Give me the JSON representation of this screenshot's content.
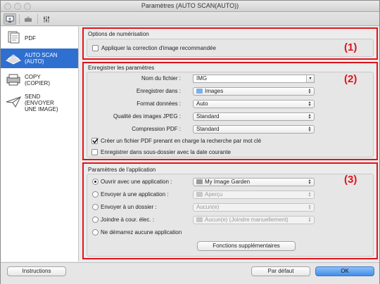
{
  "window": {
    "title": "Paramètres (AUTO SCAN(AUTO))"
  },
  "toolbar": {
    "icons": [
      "scan-from-computer-icon",
      "scan-from-operation-panel-icon",
      "general-settings-icon"
    ]
  },
  "sidebar": {
    "items": [
      {
        "label": "PDF",
        "icon": "pdf-icon",
        "selected": false
      },
      {
        "label": "AUTO SCAN\n(AUTO)",
        "icon": "auto-scan-icon",
        "selected": true
      },
      {
        "label": "COPY\n(COPIER)",
        "icon": "copy-icon",
        "selected": false
      },
      {
        "label": "SEND\n(ENVOYER\nUNE IMAGE)",
        "icon": "send-icon",
        "selected": false
      }
    ]
  },
  "scan_options": {
    "title": "Options de numérisation",
    "recommended_correction": {
      "label": "Appliquer la correction d'image recommandée",
      "checked": false
    },
    "marker": "(1)"
  },
  "save_settings": {
    "title": "Enregistrer les paramètres",
    "marker": "(2)",
    "file_name": {
      "label": "Nom du fichier :",
      "value": "IMG"
    },
    "save_in": {
      "label": "Enregistrer dans :",
      "value": "Images"
    },
    "data_format": {
      "label": "Format données :",
      "value": "Auto"
    },
    "jpeg_quality": {
      "label": "Qualité des images JPEG :",
      "value": "Standard"
    },
    "pdf_compression": {
      "label": "Compression PDF :",
      "value": "Standard"
    },
    "searchable_pdf": {
      "label": "Créer un fichier PDF prenant en charge la recherche par mot clé",
      "checked": true
    },
    "date_subfolder": {
      "label": "Enregistrer dans sous-dossier avec la date courante",
      "checked": false
    }
  },
  "app_settings": {
    "title": "Paramètres de l'application",
    "marker": "(3)",
    "open_with": {
      "label": "Ouvrir avec une application :",
      "value": "My Image Garden",
      "selected": true
    },
    "send_to_app": {
      "label": "Envoyer à une application :",
      "value": "Aperçu",
      "selected": false
    },
    "send_to_folder": {
      "label": "Envoyer à un dossier :",
      "value": "Aucun(e)",
      "selected": false
    },
    "attach_email": {
      "label": "Joindre à cour. élec. :",
      "value": "Aucun(e) (Joindre manuellement)",
      "selected": false
    },
    "no_app": {
      "label": "Ne démarrez aucune application",
      "selected": false
    },
    "more_functions": "Fonctions supplémentaires"
  },
  "footer": {
    "instructions": "Instructions",
    "defaults": "Par défaut",
    "ok": "OK"
  },
  "colors": {
    "accent": "#e0141b",
    "selection": "#2f6fd0",
    "ok_button": "#4a92ea"
  }
}
